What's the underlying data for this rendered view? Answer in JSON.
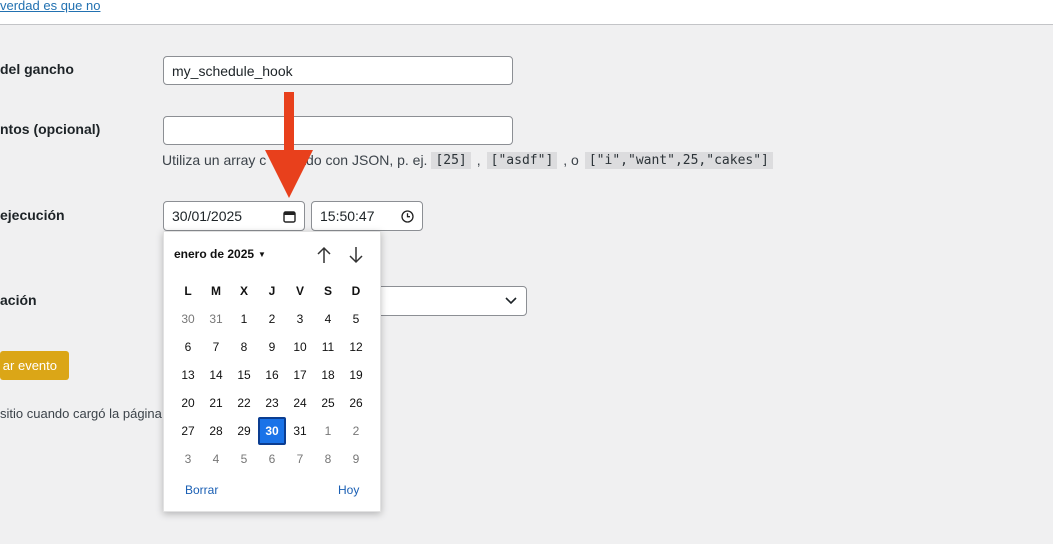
{
  "top_link": "verdad es que no",
  "form": {
    "hook_label": "del gancho",
    "hook_value": "my_schedule_hook",
    "args_label": "ntos (opcional)",
    "args_value": "",
    "hint_prefix": "Utiliza un array c",
    "hint_hidden_suffix": "odificado con JSON, p. ej.",
    "hint_covered": "ado con JSON, p. ej.",
    "hint_sep1": ",",
    "hint_sep2": ", o",
    "codes": [
      "[25]",
      "[\"asdf\"]",
      "[\"i\",\"want\",25,\"cakes\"]"
    ],
    "exec_label": "ejecución",
    "date_value": "30/01/2025",
    "time_value": "15:50:47",
    "recurrence_label": "ación",
    "submit_label": "ar evento",
    "footnote": "sitio cuando cargó la página"
  },
  "calendar": {
    "month_label": "enero de 2025",
    "weekdays": [
      "L",
      "M",
      "X",
      "J",
      "V",
      "S",
      "D"
    ],
    "weeks": [
      [
        {
          "d": "30",
          "o": true
        },
        {
          "d": "31",
          "o": true
        },
        {
          "d": "1"
        },
        {
          "d": "2"
        },
        {
          "d": "3"
        },
        {
          "d": "4"
        },
        {
          "d": "5"
        }
      ],
      [
        {
          "d": "6"
        },
        {
          "d": "7"
        },
        {
          "d": "8"
        },
        {
          "d": "9"
        },
        {
          "d": "10"
        },
        {
          "d": "11"
        },
        {
          "d": "12"
        }
      ],
      [
        {
          "d": "13"
        },
        {
          "d": "14"
        },
        {
          "d": "15"
        },
        {
          "d": "16"
        },
        {
          "d": "17"
        },
        {
          "d": "18"
        },
        {
          "d": "19"
        }
      ],
      [
        {
          "d": "20"
        },
        {
          "d": "21"
        },
        {
          "d": "22"
        },
        {
          "d": "23"
        },
        {
          "d": "24"
        },
        {
          "d": "25"
        },
        {
          "d": "26"
        }
      ],
      [
        {
          "d": "27"
        },
        {
          "d": "28"
        },
        {
          "d": "29"
        },
        {
          "d": "30",
          "s": true
        },
        {
          "d": "31"
        },
        {
          "d": "1",
          "o": true
        },
        {
          "d": "2",
          "o": true
        }
      ],
      [
        {
          "d": "3",
          "o": true
        },
        {
          "d": "4",
          "o": true
        },
        {
          "d": "5",
          "o": true
        },
        {
          "d": "6",
          "o": true
        },
        {
          "d": "7",
          "o": true
        },
        {
          "d": "8",
          "o": true
        },
        {
          "d": "9",
          "o": true
        }
      ]
    ],
    "clear_label": "Borrar",
    "today_label": "Hoy",
    "selected_color": "#1a73e8"
  },
  "annotation": {
    "type": "arrow-down",
    "color": "#e8401c"
  },
  "colors": {
    "accent_gold": "#dba617",
    "link_blue": "#2271b1"
  }
}
